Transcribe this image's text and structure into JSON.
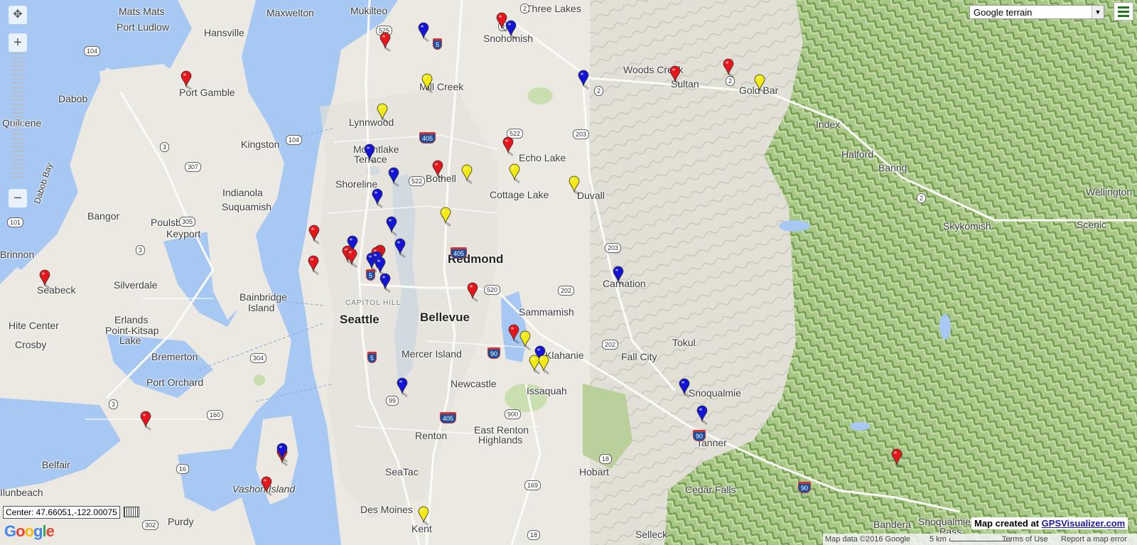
{
  "map": {
    "center_readout": "Center: 47.66051,-122.00075",
    "logo_letters": [
      "G",
      "o",
      "o",
      "g",
      "l",
      "e"
    ],
    "map_type": {
      "selected": "Google terrain"
    },
    "credit": {
      "prefix": "Map created at",
      "link": "GPSVisualizer.com"
    },
    "attribution": {
      "data": "Map data ©2016 Google",
      "scale": "5 km",
      "terms": "Terms of Use",
      "report": "Report a map error"
    },
    "zoom": {
      "in": "+",
      "out": "−"
    }
  },
  "marker_colors": {
    "red": "#e8161a",
    "blue": "#1414d8",
    "yellow": "#f2ea10"
  },
  "places": [
    {
      "name": "Mats Mats",
      "cls": "m"
    },
    {
      "name": "Maxwelton",
      "cls": "m"
    },
    {
      "name": "Mukilteo",
      "cls": "m"
    },
    {
      "name": "Three Lakes",
      "cls": "m"
    },
    {
      "name": "Port Ludlow",
      "cls": "m"
    },
    {
      "name": "Hansville",
      "cls": "m"
    },
    {
      "name": "Snohomish",
      "cls": "m"
    },
    {
      "name": "Woods Creek",
      "cls": "m"
    },
    {
      "name": "Sultan",
      "cls": "m"
    },
    {
      "name": "Gold Bar",
      "cls": "m"
    },
    {
      "name": "Dabob",
      "cls": "m"
    },
    {
      "name": "Port Gamble",
      "cls": "m"
    },
    {
      "name": "Mill Creek",
      "cls": "m"
    },
    {
      "name": "Quilcene",
      "cls": "m"
    },
    {
      "name": "Index",
      "cls": "m"
    },
    {
      "name": "Lynnwood",
      "cls": "m"
    },
    {
      "name": "Kingston",
      "cls": "m"
    },
    {
      "name": "Mountlake",
      "cls": "m"
    },
    {
      "name": "Terrace",
      "cls": "m"
    },
    {
      "name": "Echo Lake",
      "cls": "m"
    },
    {
      "name": "Halford",
      "cls": "m"
    },
    {
      "name": "Baring",
      "cls": "m"
    },
    {
      "name": "Dabob Bay",
      "cls": "s"
    },
    {
      "name": "Bothell",
      "cls": "m"
    },
    {
      "name": "Shoreline",
      "cls": "m"
    },
    {
      "name": "Cottage Lake",
      "cls": "m"
    },
    {
      "name": "Duvall",
      "cls": "m"
    },
    {
      "name": "Indianola",
      "cls": "m"
    },
    {
      "name": "Wellington",
      "cls": "m"
    },
    {
      "name": "Bangor",
      "cls": "m"
    },
    {
      "name": "Suquamish",
      "cls": "m"
    },
    {
      "name": "Poulsbo",
      "cls": "m"
    },
    {
      "name": "Skykomish",
      "cls": "m"
    },
    {
      "name": "Scenic",
      "cls": "m"
    },
    {
      "name": "Keyport",
      "cls": "m"
    },
    {
      "name": "Redmond",
      "cls": "l"
    },
    {
      "name": "Brinnon",
      "cls": "m"
    },
    {
      "name": "Carnation",
      "cls": "m"
    },
    {
      "name": "Silverdale",
      "cls": "m"
    },
    {
      "name": "Seabeck",
      "cls": "m"
    },
    {
      "name": "Bainbridge",
      "cls": "m"
    },
    {
      "name": "Island",
      "cls": "m"
    },
    {
      "name": "CAPITOL HILL",
      "cls": "tiny"
    },
    {
      "name": "Seattle",
      "cls": "l"
    },
    {
      "name": "Bellevue",
      "cls": "l"
    },
    {
      "name": "Sammamish",
      "cls": "m"
    },
    {
      "name": "Hite Center",
      "cls": "m"
    },
    {
      "name": "Erlands",
      "cls": "m"
    },
    {
      "name": "Point-Kitsap",
      "cls": "m"
    },
    {
      "name": "Lake",
      "cls": "m"
    },
    {
      "name": "Crosby",
      "cls": "m"
    },
    {
      "name": "Tokul",
      "cls": "m"
    },
    {
      "name": "Fall City",
      "cls": "m"
    },
    {
      "name": "Bremerton",
      "cls": "m"
    },
    {
      "name": "Mercer Island",
      "cls": "m"
    },
    {
      "name": "Klahanie",
      "cls": "m"
    },
    {
      "name": "Port Orchard",
      "cls": "m"
    },
    {
      "name": "Newcastle",
      "cls": "m"
    },
    {
      "name": "Snoqualmie",
      "cls": "m"
    },
    {
      "name": "Issaquah",
      "cls": "m"
    },
    {
      "name": "Renton",
      "cls": "m"
    },
    {
      "name": "East Renton",
      "cls": "m"
    },
    {
      "name": "Highlands",
      "cls": "m"
    },
    {
      "name": "Tanner",
      "cls": "m"
    },
    {
      "name": "Belfair",
      "cls": "m"
    },
    {
      "name": "SeaTac",
      "cls": "m"
    },
    {
      "name": "Hobart",
      "cls": "m"
    },
    {
      "name": "Cedar Falls",
      "cls": "m"
    },
    {
      "name": "Vashon Island",
      "cls": "it"
    },
    {
      "name": "Ilunbeach",
      "cls": "m"
    },
    {
      "name": "Purdy",
      "cls": "m"
    },
    {
      "name": "Des Moines",
      "cls": "m"
    },
    {
      "name": "Kent",
      "cls": "m"
    },
    {
      "name": "Bandera",
      "cls": "m"
    },
    {
      "name": "Snoqualmie",
      "cls": "m"
    },
    {
      "name": "Pass",
      "cls": "m"
    },
    {
      "name": "Selleck",
      "cls": "m"
    }
  ],
  "shields": [
    {
      "label": "2",
      "type": "us"
    },
    {
      "label": "9",
      "type": "state"
    },
    {
      "label": "525",
      "type": "state"
    },
    {
      "label": "5",
      "type": "i"
    },
    {
      "label": "104",
      "type": "state"
    },
    {
      "label": "2",
      "type": "us"
    },
    {
      "label": "2",
      "type": "us"
    },
    {
      "label": "405",
      "type": "i"
    },
    {
      "label": "522",
      "type": "state"
    },
    {
      "label": "104",
      "type": "state"
    },
    {
      "label": "3",
      "type": "state"
    },
    {
      "label": "307",
      "type": "state"
    },
    {
      "label": "203",
      "type": "state"
    },
    {
      "label": "522",
      "type": "state"
    },
    {
      "label": "2",
      "type": "us"
    },
    {
      "label": "305",
      "type": "state"
    },
    {
      "label": "101",
      "type": "us"
    },
    {
      "label": "405",
      "type": "i"
    },
    {
      "label": "3",
      "type": "state"
    },
    {
      "label": "203",
      "type": "state"
    },
    {
      "label": "5",
      "type": "i"
    },
    {
      "label": "520",
      "type": "state"
    },
    {
      "label": "202",
      "type": "state"
    },
    {
      "label": "202",
      "type": "state"
    },
    {
      "label": "90",
      "type": "i"
    },
    {
      "label": "5",
      "type": "i"
    },
    {
      "label": "304",
      "type": "state"
    },
    {
      "label": "3",
      "type": "state"
    },
    {
      "label": "99",
      "type": "state"
    },
    {
      "label": "405",
      "type": "i"
    },
    {
      "label": "900",
      "type": "state"
    },
    {
      "label": "160",
      "type": "state"
    },
    {
      "label": "90",
      "type": "i"
    },
    {
      "label": "16",
      "type": "state"
    },
    {
      "label": "18",
      "type": "state"
    },
    {
      "label": "169",
      "type": "state"
    },
    {
      "label": "302",
      "type": "state"
    },
    {
      "label": "18",
      "type": "state"
    },
    {
      "label": "90",
      "type": "i"
    }
  ],
  "markers": [
    {
      "c": "red"
    },
    {
      "c": "blue"
    },
    {
      "c": "red"
    },
    {
      "c": "blue"
    },
    {
      "c": "red"
    },
    {
      "c": "blue"
    },
    {
      "c": "yellow"
    },
    {
      "c": "red"
    },
    {
      "c": "red"
    },
    {
      "c": "yellow"
    },
    {
      "c": "yellow"
    },
    {
      "c": "blue"
    },
    {
      "c": "blue"
    },
    {
      "c": "red"
    },
    {
      "c": "yellow"
    },
    {
      "c": "yellow"
    },
    {
      "c": "yellow"
    },
    {
      "c": "red"
    },
    {
      "c": "blue"
    },
    {
      "c": "red"
    },
    {
      "c": "yellow"
    },
    {
      "c": "blue"
    },
    {
      "c": "red"
    },
    {
      "c": "blue"
    },
    {
      "c": "red"
    },
    {
      "c": "red"
    },
    {
      "c": "red"
    },
    {
      "c": "red"
    },
    {
      "c": "blue"
    },
    {
      "c": "blue"
    },
    {
      "c": "blue"
    },
    {
      "c": "blue"
    },
    {
      "c": "red"
    },
    {
      "c": "red"
    },
    {
      "c": "blue"
    },
    {
      "c": "blue"
    },
    {
      "c": "red"
    },
    {
      "c": "yellow"
    },
    {
      "c": "blue"
    },
    {
      "c": "yellow"
    },
    {
      "c": "yellow"
    },
    {
      "c": "blue"
    },
    {
      "c": "blue"
    },
    {
      "c": "blue"
    },
    {
      "c": "red"
    },
    {
      "c": "red"
    },
    {
      "c": "blue"
    },
    {
      "c": "red"
    },
    {
      "c": "red"
    },
    {
      "c": "yellow"
    }
  ]
}
